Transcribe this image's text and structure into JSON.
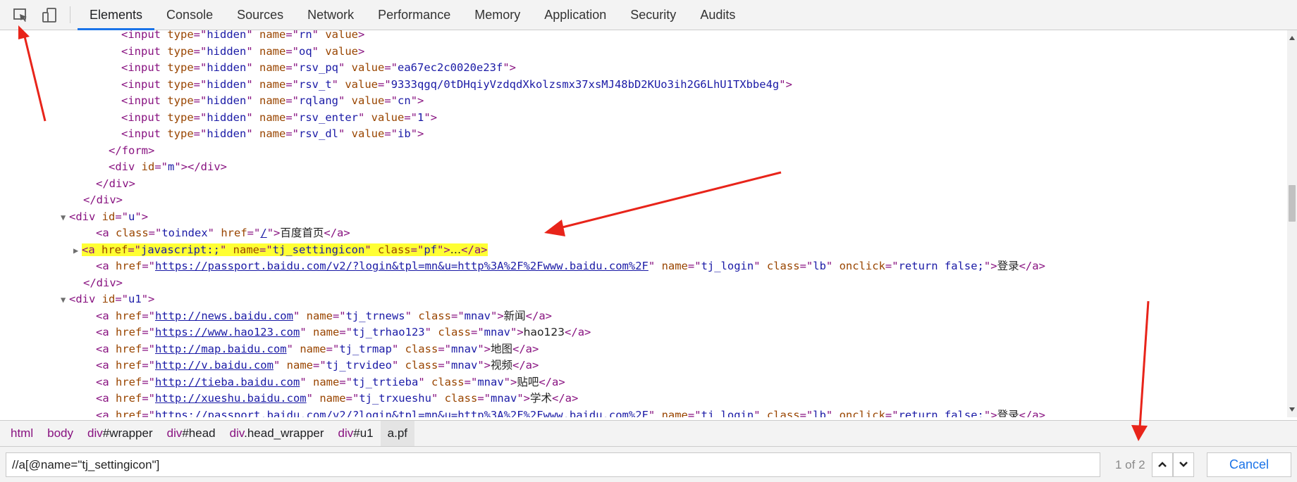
{
  "toolbar": {
    "tabs": [
      "Elements",
      "Console",
      "Sources",
      "Network",
      "Performance",
      "Memory",
      "Application",
      "Security",
      "Audits"
    ],
    "inspect_icon": "inspect-element-icon",
    "device_icon": "device-toolbar-icon"
  },
  "dom_lines": [
    {
      "indent": 10,
      "html": "<span class=\"tag\">&lt;input </span><span class=\"an\">type</span><span class=\"tag\">=\"</span><span class=\"av\">hidden</span><span class=\"tag\">\" </span><span class=\"an\">name</span><span class=\"tag\">=\"</span><span class=\"av\">rn</span><span class=\"tag\">\" </span><span class=\"an\">value</span><span class=\"tag\">&gt;</span>"
    },
    {
      "indent": 10,
      "html": "<span class=\"tag\">&lt;input </span><span class=\"an\">type</span><span class=\"tag\">=\"</span><span class=\"av\">hidden</span><span class=\"tag\">\" </span><span class=\"an\">name</span><span class=\"tag\">=\"</span><span class=\"av\">oq</span><span class=\"tag\">\" </span><span class=\"an\">value</span><span class=\"tag\">&gt;</span>"
    },
    {
      "indent": 10,
      "html": "<span class=\"tag\">&lt;input </span><span class=\"an\">type</span><span class=\"tag\">=\"</span><span class=\"av\">hidden</span><span class=\"tag\">\" </span><span class=\"an\">name</span><span class=\"tag\">=\"</span><span class=\"av\">rsv_pq</span><span class=\"tag\">\" </span><span class=\"an\">value</span><span class=\"tag\">=\"</span><span class=\"av\">ea67ec2c0020e23f</span><span class=\"tag\">\"&gt;</span>"
    },
    {
      "indent": 10,
      "html": "<span class=\"tag\">&lt;input </span><span class=\"an\">type</span><span class=\"tag\">=\"</span><span class=\"av\">hidden</span><span class=\"tag\">\" </span><span class=\"an\">name</span><span class=\"tag\">=\"</span><span class=\"av\">rsv_t</span><span class=\"tag\">\" </span><span class=\"an\">value</span><span class=\"tag\">=\"</span><span class=\"av\">9333qgq/0tDHqiyVzdqdXkolzsmx37xsMJ48bD2KUo3ih2G6LhU1TXbbe4g</span><span class=\"tag\">\"&gt;</span>"
    },
    {
      "indent": 10,
      "html": "<span class=\"tag\">&lt;input </span><span class=\"an\">type</span><span class=\"tag\">=\"</span><span class=\"av\">hidden</span><span class=\"tag\">\" </span><span class=\"an\">name</span><span class=\"tag\">=\"</span><span class=\"av\">rqlang</span><span class=\"tag\">\" </span><span class=\"an\">value</span><span class=\"tag\">=\"</span><span class=\"av\">cn</span><span class=\"tag\">\"&gt;</span>"
    },
    {
      "indent": 10,
      "html": "<span class=\"tag\">&lt;input </span><span class=\"an\">type</span><span class=\"tag\">=\"</span><span class=\"av\">hidden</span><span class=\"tag\">\" </span><span class=\"an\">name</span><span class=\"tag\">=\"</span><span class=\"av\">rsv_enter</span><span class=\"tag\">\" </span><span class=\"an\">value</span><span class=\"tag\">=\"</span><span class=\"av\">1</span><span class=\"tag\">\"&gt;</span>"
    },
    {
      "indent": 10,
      "html": "<span class=\"tag\">&lt;input </span><span class=\"an\">type</span><span class=\"tag\">=\"</span><span class=\"av\">hidden</span><span class=\"tag\">\" </span><span class=\"an\">name</span><span class=\"tag\">=\"</span><span class=\"av\">rsv_dl</span><span class=\"tag\">\" </span><span class=\"an\">value</span><span class=\"tag\">=\"</span><span class=\"av\">ib</span><span class=\"tag\">\"&gt;</span>"
    },
    {
      "indent": 9,
      "html": "<span class=\"tag\">&lt;/form&gt;</span>"
    },
    {
      "indent": 9,
      "html": "<span class=\"tag\">&lt;div </span><span class=\"an\">id</span><span class=\"tag\">=\"</span><span class=\"av\">m</span><span class=\"tag\">\"&gt;&lt;/div&gt;</span>"
    },
    {
      "indent": 8,
      "html": "<span class=\"tag\">&lt;/div&gt;</span>"
    },
    {
      "indent": 7,
      "html": "<span class=\"tag\">&lt;/div&gt;</span>"
    },
    {
      "indent": 6,
      "tri": "▼",
      "html": "<span class=\"tag\">&lt;div </span><span class=\"an\">id</span><span class=\"tag\">=\"</span><span class=\"av\">u</span><span class=\"tag\">\"&gt;</span>"
    },
    {
      "indent": 8,
      "html": "<span class=\"tag\">&lt;a </span><span class=\"an\">class</span><span class=\"tag\">=\"</span><span class=\"av\">toindex</span><span class=\"tag\">\" </span><span class=\"an\">href</span><span class=\"tag\">=\"</span><span class=\"lnk\">/</span><span class=\"tag\">\"&gt;</span><span class=\"tx\">百度首页</span><span class=\"tag\">&lt;/a&gt;</span>"
    },
    {
      "indent": 7,
      "tri": "▶",
      "highlight": true,
      "html": "<span class=\"hl\"><span class=\"tag\">&lt;a </span><span class=\"an\">href</span><span class=\"tag\">=\"</span><span class=\"av\">javascript:;</span><span class=\"tag\">\" </span><span class=\"an\">name</span><span class=\"tag\">=\"</span><span class=\"av\">tj_settingicon</span><span class=\"tag\">\" </span><span class=\"an\">class</span><span class=\"tag\">=\"</span><span class=\"av\">pf</span><span class=\"tag\">\"&gt;</span><span class=\"tx\">…</span><span class=\"tag\">&lt;/a&gt;</span></span>"
    },
    {
      "indent": 8,
      "html": "<span class=\"tag\">&lt;a </span><span class=\"an\">href</span><span class=\"tag\">=\"</span><span class=\"lnk\">https://passport.baidu.com/v2/?login&amp;tpl=mn&amp;u=http%3A%2F%2Fwww.baidu.com%2F</span><span class=\"tag\">\" </span><span class=\"an\">name</span><span class=\"tag\">=\"</span><span class=\"av\">tj_login</span><span class=\"tag\">\" </span><span class=\"an\">class</span><span class=\"tag\">=\"</span><span class=\"av\">lb</span><span class=\"tag\">\" </span><span class=\"an\">onclick</span><span class=\"tag\">=\"</span><span class=\"av\">return false;</span><span class=\"tag\">\"&gt;</span><span class=\"tx\">登录</span><span class=\"tag\">&lt;/a&gt;</span>"
    },
    {
      "indent": 7,
      "html": "<span class=\"tag\">&lt;/div&gt;</span>"
    },
    {
      "indent": 6,
      "tri": "▼",
      "html": "<span class=\"tag\">&lt;div </span><span class=\"an\">id</span><span class=\"tag\">=\"</span><span class=\"av\">u1</span><span class=\"tag\">\"&gt;</span>"
    },
    {
      "indent": 8,
      "html": "<span class=\"tag\">&lt;a </span><span class=\"an\">href</span><span class=\"tag\">=\"</span><span class=\"lnk\">http://news.baidu.com</span><span class=\"tag\">\" </span><span class=\"an\">name</span><span class=\"tag\">=\"</span><span class=\"av\">tj_trnews</span><span class=\"tag\">\" </span><span class=\"an\">class</span><span class=\"tag\">=\"</span><span class=\"av\">mnav</span><span class=\"tag\">\"&gt;</span><span class=\"tx\">新闻</span><span class=\"tag\">&lt;/a&gt;</span>"
    },
    {
      "indent": 8,
      "html": "<span class=\"tag\">&lt;a </span><span class=\"an\">href</span><span class=\"tag\">=\"</span><span class=\"lnk\">https://www.hao123.com</span><span class=\"tag\">\" </span><span class=\"an\">name</span><span class=\"tag\">=\"</span><span class=\"av\">tj_trhao123</span><span class=\"tag\">\" </span><span class=\"an\">class</span><span class=\"tag\">=\"</span><span class=\"av\">mnav</span><span class=\"tag\">\"&gt;</span><span class=\"tx\">hao123</span><span class=\"tag\">&lt;/a&gt;</span>"
    },
    {
      "indent": 8,
      "html": "<span class=\"tag\">&lt;a </span><span class=\"an\">href</span><span class=\"tag\">=\"</span><span class=\"lnk\">http://map.baidu.com</span><span class=\"tag\">\" </span><span class=\"an\">name</span><span class=\"tag\">=\"</span><span class=\"av\">tj_trmap</span><span class=\"tag\">\" </span><span class=\"an\">class</span><span class=\"tag\">=\"</span><span class=\"av\">mnav</span><span class=\"tag\">\"&gt;</span><span class=\"tx\">地图</span><span class=\"tag\">&lt;/a&gt;</span>"
    },
    {
      "indent": 8,
      "html": "<span class=\"tag\">&lt;a </span><span class=\"an\">href</span><span class=\"tag\">=\"</span><span class=\"lnk\">http://v.baidu.com</span><span class=\"tag\">\" </span><span class=\"an\">name</span><span class=\"tag\">=\"</span><span class=\"av\">tj_trvideo</span><span class=\"tag\">\" </span><span class=\"an\">class</span><span class=\"tag\">=\"</span><span class=\"av\">mnav</span><span class=\"tag\">\"&gt;</span><span class=\"tx\">视频</span><span class=\"tag\">&lt;/a&gt;</span>"
    },
    {
      "indent": 8,
      "html": "<span class=\"tag\">&lt;a </span><span class=\"an\">href</span><span class=\"tag\">=\"</span><span class=\"lnk\">http://tieba.baidu.com</span><span class=\"tag\">\" </span><span class=\"an\">name</span><span class=\"tag\">=\"</span><span class=\"av\">tj_trtieba</span><span class=\"tag\">\" </span><span class=\"an\">class</span><span class=\"tag\">=\"</span><span class=\"av\">mnav</span><span class=\"tag\">\"&gt;</span><span class=\"tx\">贴吧</span><span class=\"tag\">&lt;/a&gt;</span>"
    },
    {
      "indent": 8,
      "html": "<span class=\"tag\">&lt;a </span><span class=\"an\">href</span><span class=\"tag\">=\"</span><span class=\"lnk\">http://xueshu.baidu.com</span><span class=\"tag\">\" </span><span class=\"an\">name</span><span class=\"tag\">=\"</span><span class=\"av\">tj_trxueshu</span><span class=\"tag\">\" </span><span class=\"an\">class</span><span class=\"tag\">=\"</span><span class=\"av\">mnav</span><span class=\"tag\">\"&gt;</span><span class=\"tx\">学术</span><span class=\"tag\">&lt;/a&gt;</span>"
    },
    {
      "indent": 8,
      "html": "<span class=\"tag\">&lt;a </span><span class=\"an\">href</span><span class=\"tag\">=\"</span><span class=\"lnk\">https://passport.baidu.com/v2/?login&amp;tpl=mn&amp;u=http%3A%2F%2Fwww.baidu.com%2F</span><span class=\"tag\">\" </span><span class=\"an\">name</span><span class=\"tag\">=\"</span><span class=\"av\">tj_login</span><span class=\"tag\">\" </span><span class=\"an\">class</span><span class=\"tag\">=\"</span><span class=\"av\">lb</span><span class=\"tag\">\" </span><span class=\"an\">onclick</span><span class=\"tag\">=\"</span><span class=\"av\">return false;</span><span class=\"tag\">\"&gt;</span><span class=\"tx\">登录</span><span class=\"tag\">&lt;/a&gt;</span>"
    }
  ],
  "breadcrumb": [
    {
      "tag": "html",
      "id": ""
    },
    {
      "tag": "body",
      "id": ""
    },
    {
      "tag": "div",
      "id": "#wrapper"
    },
    {
      "tag": "div",
      "id": "#head"
    },
    {
      "tag": "div",
      "id": ".head_wrapper"
    },
    {
      "tag": "div",
      "id": "#u1"
    },
    {
      "tag": "a",
      "id": ".pf",
      "selected": true
    }
  ],
  "search": {
    "query": "//a[@name=\"tj_settingicon\"]",
    "match_count": "1 of 2",
    "cancel_label": "Cancel"
  },
  "colors": {
    "highlight": "#ffff33",
    "annotation_arrow": "#e8241a",
    "tab_active_underline": "#1a73e8"
  }
}
